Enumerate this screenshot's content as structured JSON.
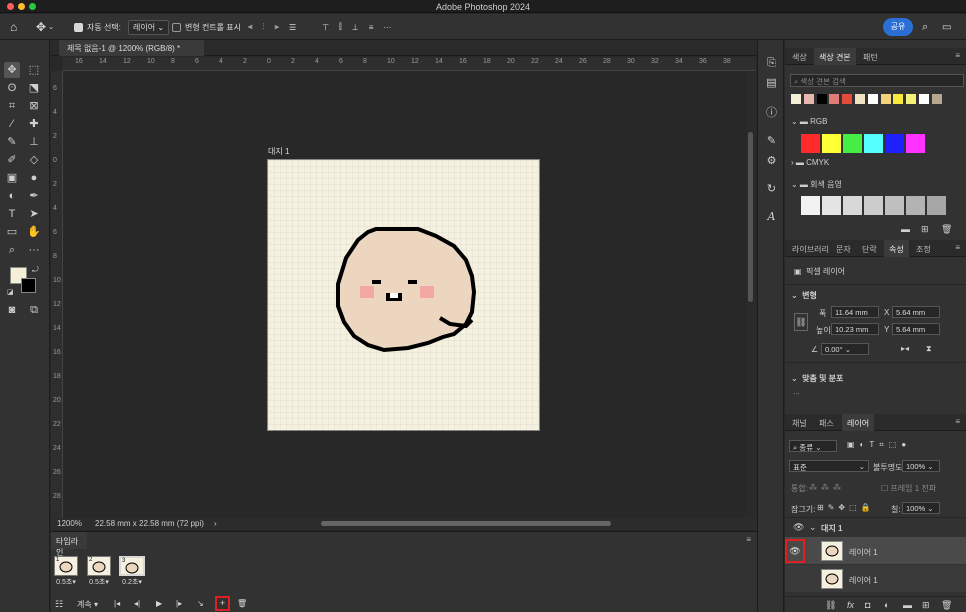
{
  "app": {
    "title": "Adobe Photoshop 2024"
  },
  "options_bar": {
    "auto_select_label": "자동 선택:",
    "auto_select_value": "레이어",
    "transform_controls_label": "변형 컨트롤 표시",
    "share_label": "공유"
  },
  "document": {
    "tab_title": "제목 없음-1 @ 1200% (RGB/8) *",
    "artboard_label": "대지 1",
    "zoom": "1200%",
    "size_info": "22.58 mm x 22.58 mm (72 ppi)"
  },
  "rulers": {
    "h_ticks": [
      "16",
      "14",
      "12",
      "10",
      "8",
      "6",
      "4",
      "2",
      "0",
      "2",
      "4",
      "6",
      "8",
      "10",
      "12",
      "14",
      "16",
      "18",
      "20",
      "22",
      "24",
      "26",
      "28",
      "30",
      "32",
      "34",
      "36",
      "38"
    ],
    "v_ticks": [
      "6",
      "4",
      "2",
      "0",
      "2",
      "4",
      "6",
      "8",
      "10",
      "12",
      "14",
      "16",
      "18",
      "20",
      "22",
      "24",
      "26",
      "28"
    ]
  },
  "timeline": {
    "tab_label": "타임라인",
    "frames": [
      {
        "num": "1",
        "duration": "0.5초▾"
      },
      {
        "num": "2",
        "duration": "0.5초▾"
      },
      {
        "num": "3",
        "duration": "0.2초▾"
      }
    ],
    "loop_label": "계속",
    "active_frame": 3
  },
  "swatches_panel": {
    "tabs": [
      "색상",
      "색상 견본",
      "패턴"
    ],
    "active_tab": "색상 견본",
    "search_placeholder": "색상 견본 검색",
    "recent": [
      "#f5efd8",
      "#e8b7b0",
      "#000000",
      "#e07b78",
      "#e34b3a",
      "#efe3c4",
      "#ffffff",
      "#f2d27a",
      "#f7e93d",
      "#f6ef7a",
      "#ffffff",
      "#b5a690"
    ],
    "groups": [
      {
        "name": "RGB",
        "colors": [
          "#ff2a2a",
          "#ffff33",
          "#44ee44",
          "#55ffff",
          "#2020ff",
          "#ff33ff"
        ]
      },
      {
        "name": "CMYK",
        "colors": []
      },
      {
        "name": "회색 음영",
        "colors": [
          "#f2f2f2",
          "#e4e4e4",
          "#d8d8d8",
          "#cccccc",
          "#bfbfbf",
          "#b3b3b3",
          "#a6a6a6"
        ]
      }
    ]
  },
  "properties_panel": {
    "tabs": [
      "라이브러리",
      "문자",
      "단락",
      "속성",
      "조정"
    ],
    "active_tab": "속성",
    "layer_type": "픽셀 레이어",
    "transform_title": "변형",
    "w_label": "폭",
    "w_value": "11.64 mm",
    "x_label": "X",
    "x_value": "5.64 mm",
    "h_label": "높이",
    "h_value": "10.23 mm",
    "y_label": "Y",
    "y_value": "5.64 mm",
    "angle_value": "0.00°",
    "align_title": "맞춤 및 분포",
    "align_more": "..."
  },
  "layers_panel": {
    "tabs": [
      "채널",
      "패스",
      "레이어"
    ],
    "active_tab": "레이어",
    "filter_label": "종류",
    "blend_mode": "표준",
    "opacity_label": "불투명도:",
    "opacity_value": "100%",
    "unify_label": "통합:",
    "propagate_label": "프레임 1 전파",
    "lock_label": "잠그기:",
    "fill_label": "칠:",
    "fill_value": "100%",
    "group_name": "대지 1",
    "layers": [
      {
        "name": "레이어 1",
        "visible": true,
        "selected": true
      },
      {
        "name": "레이어 1",
        "visible": false,
        "selected": false
      }
    ]
  }
}
